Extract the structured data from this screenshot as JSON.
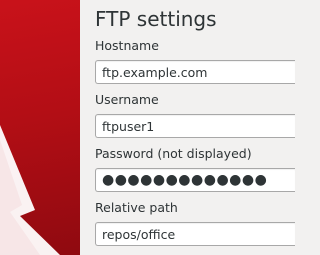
{
  "dialog": {
    "title": "FTP settings"
  },
  "fields": {
    "hostname": {
      "label": "Hostname",
      "value": "ftp.example.com"
    },
    "username": {
      "label": "Username",
      "value": "ftpuser1"
    },
    "password": {
      "label": "Password (not displayed)",
      "value": "●●●●●●●●●●●●●"
    },
    "relative_path": {
      "label": "Relative path",
      "value": "repos/office"
    }
  },
  "colors": {
    "sidebar_red": "#c9121a",
    "arrow_white": "#ffffff",
    "background": "#f2f1f0"
  },
  "sidebar": {
    "graphic": "upload-arrow-icon"
  }
}
